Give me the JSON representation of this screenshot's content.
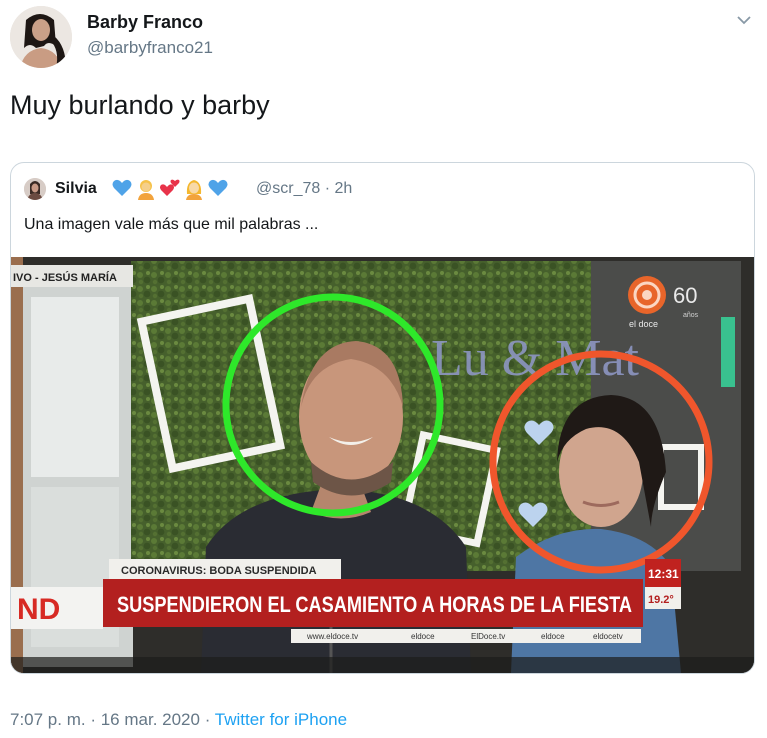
{
  "tweet": {
    "author_name": "Barby Franco",
    "author_handle": "@barbyfranco21",
    "text": "Muy burlando y barby",
    "time": "7:07 p. m.",
    "separator": " · ",
    "date": "16 mar. 2020",
    "client": "Twitter for iPhone"
  },
  "quoted": {
    "author_name": "Silvia",
    "emojis": [
      "blue-heart-emoji",
      "person-blond-emoji",
      "two-hearts-emoji",
      "woman-blond-emoji",
      "blue-heart-emoji"
    ],
    "handle_time": "@scr_78 · 2h",
    "text": "Una imagen vale más que mil palabras ..."
  },
  "tv_image": {
    "live_tag": "IVO - JESÚS MARÍA",
    "backdrop_text": "Lu & Mat",
    "channel": "el doce",
    "anniversary": "60",
    "anniversary_sub": "años",
    "logo_partial": "ND",
    "kicker": "CORONAVIRUS: BODA SUSPENDIDA",
    "headline": "SUSPENDIERON EL CASAMIENTO A HORAS DE LA FIESTA",
    "clock": "12:31",
    "temperature": "19.2°",
    "socials": [
      "www.eldoce.tv",
      "eldoce",
      "ElDoce.tv",
      "eldoce",
      "eldocetv"
    ],
    "circle_colors": {
      "left": "#2ee82a",
      "right": "#f0562c"
    }
  }
}
